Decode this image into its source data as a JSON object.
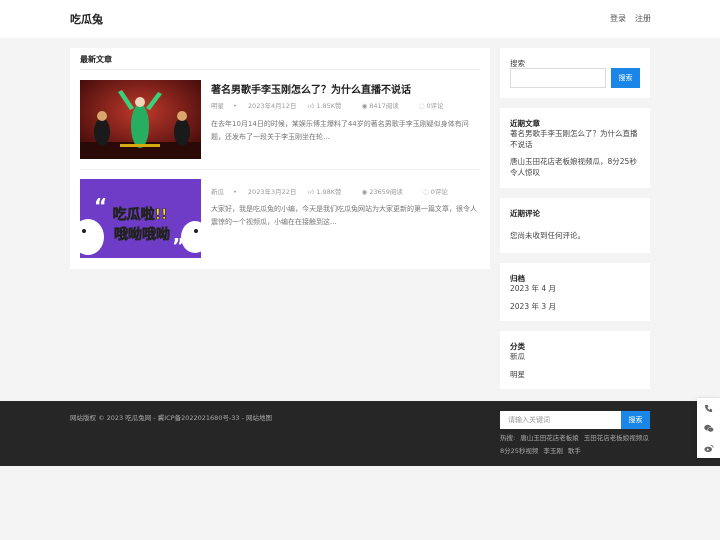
{
  "header": {
    "logo": "吃瓜兔",
    "nav": [
      "登录",
      "注册"
    ]
  },
  "main": {
    "section_title": "最新文章",
    "posts": [
      {
        "title": "著名男歌手李玉刚怎么了？为什么直播不说话",
        "category": "明星",
        "date": "2023年4月12日",
        "likes": "1.85K赞",
        "views": "8417阅读",
        "comments": "0评论",
        "excerpt": "在去年10月14日的时候，某娱乐博主爆料了44岁的著名男歌手李玉刚疑似身体有问题，还发布了一段关于李玉刚坐在轮..."
      },
      {
        "title": "",
        "category": "新瓜",
        "date": "2023年3月22日",
        "likes": "1.98K赞",
        "views": "23659阅读",
        "comments": "0评论",
        "excerpt": "大家好，我是吃瓜兔的小编，今天是我们吃瓜兔网站为大家更新的第一篇文章，很令人震惊的一个视频瓜，小编在在接触到这...",
        "thumb_line1": "吃瓜啦!!",
        "thumb_line2": "哦呦哦呦"
      }
    ]
  },
  "sidebar": {
    "search": {
      "label": "搜索",
      "placeholder": "",
      "button": "搜索"
    },
    "recent_posts": {
      "title": "近期文章",
      "items": [
        "著名男歌手李玉刚怎么了？为什么直播不说话",
        "唐山玉田花店老板娘视频瓜，8分25秒令人惊叹"
      ]
    },
    "recent_comments": {
      "title": "近期评论",
      "empty": "您尚未收到任何评论。"
    },
    "archives": {
      "title": "归档",
      "items": [
        "2023 年 4 月",
        "2023 年 3 月"
      ]
    },
    "categories": {
      "title": "分类",
      "items": [
        "新瓜",
        "明星"
      ]
    }
  },
  "footer": {
    "copyright": "网站版权 © 2023 吃瓜兔网 - 冀ICP备2022021680号-33 - 网站地图",
    "search_placeholder": "请输入关键词",
    "search_button": "搜索",
    "hot_label": "热搜:",
    "hot_items": [
      "唐山玉田花店老板娘",
      "玉田花店老板娘视频瓜",
      "8分25秒视频",
      "李玉刚",
      "歌手"
    ]
  },
  "float_icons": [
    "phone-icon",
    "wechat-icon",
    "weibo-icon"
  ],
  "colors": {
    "accent": "#1a86e8",
    "footer_bg": "#262626",
    "thumb1_bg": "#8b1a1a",
    "thumb2_bg": "#6f3cc8"
  }
}
